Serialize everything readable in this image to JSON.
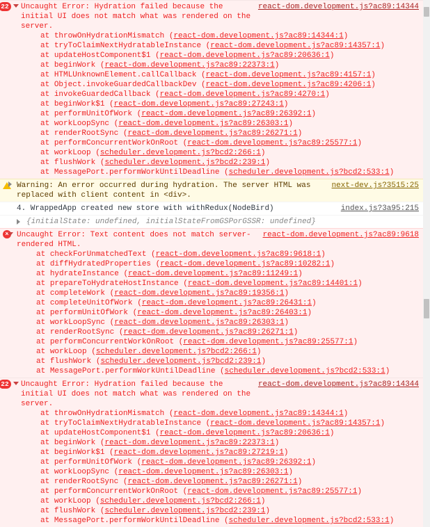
{
  "errors": [
    {
      "type": "error",
      "badge": "22",
      "expanded": true,
      "message": "Uncaught Error: Hydration failed because the initial UI does not match what was rendered on the server.",
      "source": "react-dom.development.js?ac89:14344",
      "stack": [
        {
          "fn": "throwOnHydrationMismatch",
          "loc": "react-dom.development.js?ac89:14344:1"
        },
        {
          "fn": "tryToClaimNextHydratableInstance",
          "loc": "react-dom.development.js?ac89:14357:1"
        },
        {
          "fn": "updateHostComponent$1",
          "loc": "react-dom.development.js?ac89:20636:1"
        },
        {
          "fn": "beginWork",
          "loc": "react-dom.development.js?ac89:22373:1"
        },
        {
          "fn": "HTMLUnknownElement.callCallback",
          "loc": "react-dom.development.js?ac89:4157:1"
        },
        {
          "fn": "Object.invokeGuardedCallbackDev",
          "loc": "react-dom.development.js?ac89:4206:1"
        },
        {
          "fn": "invokeGuardedCallback",
          "loc": "react-dom.development.js?ac89:4270:1"
        },
        {
          "fn": "beginWork$1",
          "loc": "react-dom.development.js?ac89:27243:1"
        },
        {
          "fn": "performUnitOfWork",
          "loc": "react-dom.development.js?ac89:26392:1"
        },
        {
          "fn": "workLoopSync",
          "loc": "react-dom.development.js?ac89:26303:1"
        },
        {
          "fn": "renderRootSync",
          "loc": "react-dom.development.js?ac89:26271:1"
        },
        {
          "fn": "performConcurrentWorkOnRoot",
          "loc": "react-dom.development.js?ac89:25577:1"
        },
        {
          "fn": "workLoop",
          "loc": "scheduler.development.js?bcd2:266:1"
        },
        {
          "fn": "flushWork",
          "loc": "scheduler.development.js?bcd2:239:1"
        },
        {
          "fn": "MessagePort.performWorkUntilDeadline",
          "loc": "scheduler.development.js?bcd2:533:1"
        }
      ]
    },
    {
      "type": "warning",
      "message": "Warning: An error occurred during hydration. The server HTML was replaced with client content in <div>.",
      "source": "next-dev.js?3515:25"
    },
    {
      "type": "log",
      "message": "4. WrappedApp created new store with withRedux(NodeBird)",
      "source": "index.js?3a95:215"
    },
    {
      "type": "verbose",
      "message": "{initialState: undefined, initialStateFromGSPorGSSR: undefined}"
    },
    {
      "type": "error-block",
      "iconx": true,
      "expanded": true,
      "message": "Uncaught Error: Text content does not match server-rendered HTML.",
      "source": "react-dom.development.js?ac89:9618",
      "stack": [
        {
          "fn": "checkForUnmatchedText",
          "loc": "react-dom.development.js?ac89:9618:1"
        },
        {
          "fn": "diffHydratedProperties",
          "loc": "react-dom.development.js?ac89:10282:1"
        },
        {
          "fn": "hydrateInstance",
          "loc": "react-dom.development.js?ac89:11249:1"
        },
        {
          "fn": "prepareToHydrateHostInstance",
          "loc": "react-dom.development.js?ac89:14401:1"
        },
        {
          "fn": "completeWork",
          "loc": "react-dom.development.js?ac89:19356:1"
        },
        {
          "fn": "completeUnitOfWork",
          "loc": "react-dom.development.js?ac89:26431:1"
        },
        {
          "fn": "performUnitOfWork",
          "loc": "react-dom.development.js?ac89:26403:1"
        },
        {
          "fn": "workLoopSync",
          "loc": "react-dom.development.js?ac89:26303:1"
        },
        {
          "fn": "renderRootSync",
          "loc": "react-dom.development.js?ac89:26271:1"
        },
        {
          "fn": "performConcurrentWorkOnRoot",
          "loc": "react-dom.development.js?ac89:25577:1"
        },
        {
          "fn": "workLoop",
          "loc": "scheduler.development.js?bcd2:266:1"
        },
        {
          "fn": "flushWork",
          "loc": "scheduler.development.js?bcd2:239:1"
        },
        {
          "fn": "MessagePort.performWorkUntilDeadline",
          "loc": "scheduler.development.js?bcd2:533:1"
        }
      ]
    },
    {
      "type": "error",
      "badge": "22",
      "expanded": true,
      "message": "Uncaught Error: Hydration failed because the initial UI does not match what was rendered on the server.",
      "source": "react-dom.development.js?ac89:14344",
      "stack": [
        {
          "fn": "throwOnHydrationMismatch",
          "loc": "react-dom.development.js?ac89:14344:1"
        },
        {
          "fn": "tryToClaimNextHydratableInstance",
          "loc": "react-dom.development.js?ac89:14357:1"
        },
        {
          "fn": "updateHostComponent$1",
          "loc": "react-dom.development.js?ac89:20636:1"
        },
        {
          "fn": "beginWork",
          "loc": "react-dom.development.js?ac89:22373:1"
        },
        {
          "fn": "beginWork$1",
          "loc": "react-dom.development.js?ac89:27219:1"
        },
        {
          "fn": "performUnitOfWork",
          "loc": "react-dom.development.js?ac89:26392:1"
        },
        {
          "fn": "workLoopSync",
          "loc": "react-dom.development.js?ac89:26303:1"
        },
        {
          "fn": "renderRootSync",
          "loc": "react-dom.development.js?ac89:26271:1"
        },
        {
          "fn": "performConcurrentWorkOnRoot",
          "loc": "react-dom.development.js?ac89:25577:1"
        },
        {
          "fn": "workLoop",
          "loc": "scheduler.development.js?bcd2:266:1"
        },
        {
          "fn": "flushWork",
          "loc": "scheduler.development.js?bcd2:239:1"
        },
        {
          "fn": "MessagePort.performWorkUntilDeadline",
          "loc": "scheduler.development.js?bcd2:533:1"
        }
      ]
    }
  ],
  "at_label": "at"
}
